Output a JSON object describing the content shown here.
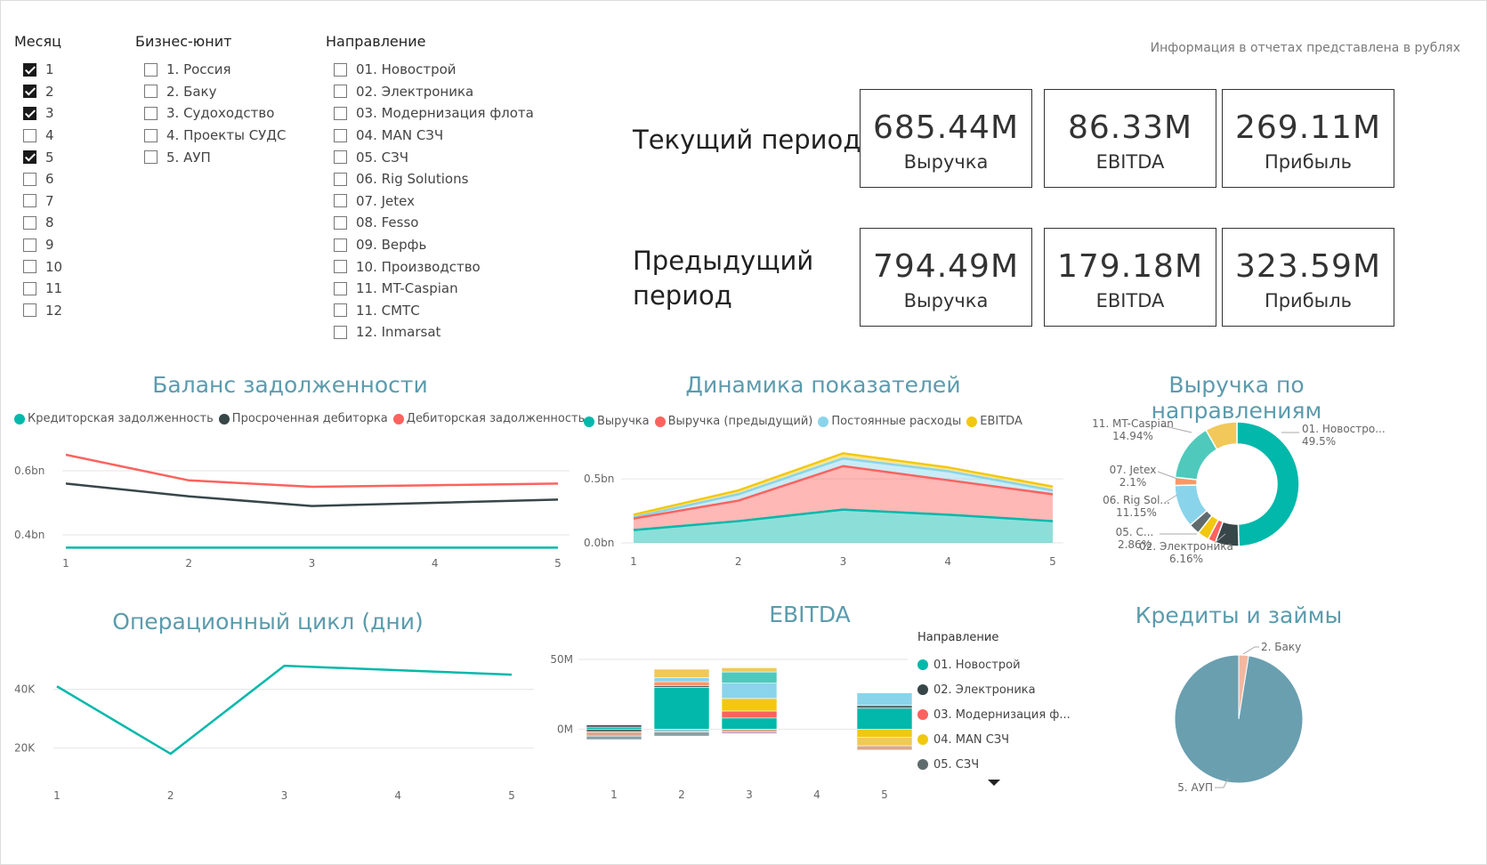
{
  "slicers": {
    "month": {
      "title": "Месяц",
      "items": [
        {
          "label": "1",
          "checked": true
        },
        {
          "label": "2",
          "checked": true
        },
        {
          "label": "3",
          "checked": true
        },
        {
          "label": "4",
          "checked": false
        },
        {
          "label": "5",
          "checked": true
        },
        {
          "label": "6",
          "checked": false
        },
        {
          "label": "7",
          "checked": false
        },
        {
          "label": "8",
          "checked": false
        },
        {
          "label": "9",
          "checked": false
        },
        {
          "label": "10",
          "checked": false
        },
        {
          "label": "11",
          "checked": false
        },
        {
          "label": "12",
          "checked": false
        }
      ]
    },
    "unit": {
      "title": "Бизнес-юнит",
      "items": [
        {
          "label": "1. Россия",
          "checked": false
        },
        {
          "label": "2. Баку",
          "checked": false
        },
        {
          "label": "3. Судоходство",
          "checked": false
        },
        {
          "label": "4. Проекты СУДС",
          "checked": false
        },
        {
          "label": "5. АУП",
          "checked": false
        }
      ]
    },
    "direction": {
      "title": "Направление",
      "items": [
        {
          "label": "01. Новострой",
          "checked": false
        },
        {
          "label": "02. Электроника",
          "checked": false
        },
        {
          "label": "03. Модернизация флота",
          "checked": false
        },
        {
          "label": "04. MAN СЗЧ",
          "checked": false
        },
        {
          "label": "05. СЗЧ",
          "checked": false
        },
        {
          "label": "06. Rig Solutions",
          "checked": false
        },
        {
          "label": "07. Jetex",
          "checked": false
        },
        {
          "label": "08. Fesso",
          "checked": false
        },
        {
          "label": "09. Верфь",
          "checked": false
        },
        {
          "label": "10. Производство",
          "checked": false
        },
        {
          "label": "11. MT-Caspian",
          "checked": false
        },
        {
          "label": "11. СМТС",
          "checked": false
        },
        {
          "label": "12. Inmarsat",
          "checked": false
        }
      ]
    }
  },
  "info_note": "Информация в отчетах представлена в рублях",
  "current": {
    "label": "Текущий период",
    "cards": [
      {
        "value": "685.44M",
        "label": "Выручка"
      },
      {
        "value": "86.33M",
        "label": "EBITDA"
      },
      {
        "value": "269.11M",
        "label": "Прибыль"
      }
    ]
  },
  "previous": {
    "label_line1": "Предыдущий",
    "label_line2": "период",
    "cards": [
      {
        "value": "794.49M",
        "label": "Выручка"
      },
      {
        "value": "179.18M",
        "label": "EBITDA"
      },
      {
        "value": "323.59M",
        "label": "Прибыль"
      }
    ]
  },
  "colors": {
    "teal": "#01b8aa",
    "dark": "#374649",
    "red": "#fd625e",
    "yellow": "#f2c80f",
    "gray": "#5f6b6d",
    "lightblue": "#8ad4eb",
    "orange": "#fe9666",
    "purple": "#a66999",
    "steel": "#6a9fb0",
    "peach": "#f4b8a0",
    "title": "#5b9bad"
  },
  "chart_data": [
    {
      "id": "debt",
      "type": "line",
      "title": "Баланс задолженности",
      "x": [
        "1",
        "2",
        "3",
        "4",
        "5"
      ],
      "y_ticks": [
        "0.4bn",
        "0.6bn"
      ],
      "ylim": [
        0.3,
        0.7
      ],
      "series": [
        {
          "name": "Кредиторская задолженность",
          "color": "#01b8aa",
          "values": [
            0.36,
            0.36,
            0.36,
            0.36,
            0.36
          ]
        },
        {
          "name": "Просроченная дебиторка",
          "color": "#374649",
          "values": [
            0.56,
            0.52,
            0.49,
            0.5,
            0.51
          ]
        },
        {
          "name": "Дебиторская задолженность",
          "color": "#fd625e",
          "values": [
            0.65,
            0.57,
            0.55,
            0.555,
            0.56
          ]
        }
      ]
    },
    {
      "id": "dynamics",
      "type": "area",
      "title": "Динамика показателей",
      "x": [
        "1",
        "2",
        "3",
        "4",
        "5"
      ],
      "y_ticks": [
        "0.0bn",
        "0.5bn"
      ],
      "ylim": [
        0,
        0.8
      ],
      "series": [
        {
          "name": "Выручка",
          "color": "#01b8aa",
          "values": [
            0.1,
            0.17,
            0.26,
            0.22,
            0.17
          ]
        },
        {
          "name": "Выручка (предыдущий)",
          "color": "#fd625e",
          "values": [
            0.19,
            0.33,
            0.6,
            0.49,
            0.38
          ]
        },
        {
          "name": "Постоянные расходы",
          "color": "#8ad4eb",
          "values": [
            0.2,
            0.38,
            0.66,
            0.56,
            0.41
          ]
        },
        {
          "name": "EBITDA",
          "color": "#f2c80f",
          "values": [
            0.22,
            0.41,
            0.7,
            0.59,
            0.44
          ]
        }
      ]
    },
    {
      "id": "rev_dir",
      "type": "pie",
      "title": "Выручка по направлениям",
      "labels": [
        {
          "name": "01. Новостро...",
          "pct": "49.5%"
        },
        {
          "name": "02. Электроника",
          "pct": "6.16%"
        },
        {
          "name": "05. С...",
          "pct": "2.86%"
        },
        {
          "name": "06. Rig Sol...",
          "pct": "11.15%"
        },
        {
          "name": "07. Jetex",
          "pct": "2.1%"
        },
        {
          "name": "11. MT-Caspian",
          "pct": "14.94%"
        }
      ],
      "slices": [
        {
          "value": 49.5,
          "color": "#01b8aa"
        },
        {
          "value": 6.16,
          "color": "#374649"
        },
        {
          "value": 2.0,
          "color": "#fd625e"
        },
        {
          "value": 3.0,
          "color": "#f2c80f"
        },
        {
          "value": 2.86,
          "color": "#5f6b6d"
        },
        {
          "value": 11.15,
          "color": "#8ad4eb"
        },
        {
          "value": 2.1,
          "color": "#fe9666"
        },
        {
          "value": 14.94,
          "color": "#4fc9bb"
        },
        {
          "value": 8.29,
          "color": "#f2c85a"
        }
      ]
    },
    {
      "id": "opcycle",
      "type": "line",
      "title": "Операционный цикл (дни)",
      "x": [
        "1",
        "2",
        "3",
        "4",
        "5"
      ],
      "y_ticks": [
        "20K",
        "40K"
      ],
      "ylim": [
        8000,
        52000
      ],
      "series": [
        {
          "color": "#01b8aa",
          "values": [
            41000,
            18000,
            48000,
            46500,
            45000
          ]
        }
      ]
    },
    {
      "id": "ebitda",
      "type": "bar",
      "title": "EBITDA",
      "x": [
        "1",
        "2",
        "3",
        "4",
        "5"
      ],
      "y_ticks": [
        "0M",
        "50M"
      ],
      "ylim": [
        -10,
        50
      ],
      "legend_title": "Направление",
      "legend": [
        {
          "name": "01. Новострой",
          "color": "#01b8aa"
        },
        {
          "name": "02. Электроника",
          "color": "#374649"
        },
        {
          "name": "03. Модернизация ф...",
          "color": "#fd625e"
        },
        {
          "name": "04. MAN СЗЧ",
          "color": "#f2c80f"
        },
        {
          "name": "05. СЗЧ",
          "color": "#5f6b6d"
        }
      ],
      "stacks": [
        [
          {
            "v": 1.5,
            "c": "#01b8aa"
          },
          {
            "v": 1.5,
            "c": "#374649"
          },
          {
            "v": -2,
            "c": "#5f6b6d"
          },
          {
            "v": -3,
            "c": "#d9a98c"
          },
          {
            "v": -2.5,
            "c": "#8aa0a6"
          }
        ],
        [
          {
            "v": 30,
            "c": "#01b8aa"
          },
          {
            "v": 1,
            "c": "#374649"
          },
          {
            "v": 3,
            "c": "#fe9666"
          },
          {
            "v": 3,
            "c": "#8ad4eb"
          },
          {
            "v": 6,
            "c": "#f2c85a"
          },
          {
            "v": -2,
            "c": "#a0c8d0"
          },
          {
            "v": -3,
            "c": "#8aa0a6"
          }
        ],
        [
          {
            "v": 8,
            "c": "#01b8aa"
          },
          {
            "v": 5,
            "c": "#fd625e"
          },
          {
            "v": 9,
            "c": "#f2c80f"
          },
          {
            "v": 11,
            "c": "#8ad4eb"
          },
          {
            "v": 8,
            "c": "#4fc9bb"
          },
          {
            "v": 3,
            "c": "#f2c85a"
          },
          {
            "v": -2,
            "c": "#d9a98c"
          },
          {
            "v": -1,
            "c": "#a66999"
          }
        ],
        [],
        [
          {
            "v": 15,
            "c": "#01b8aa"
          },
          {
            "v": 2,
            "c": "#5f6b6d"
          },
          {
            "v": 9,
            "c": "#8ad4eb"
          },
          {
            "v": -6,
            "c": "#f2c80f"
          },
          {
            "v": -6,
            "c": "#f2c85a"
          },
          {
            "v": -3,
            "c": "#d9a98c"
          }
        ]
      ]
    },
    {
      "id": "loans",
      "type": "pie",
      "title": "Кредиты и займы",
      "slices": [
        {
          "name": "2. Баку",
          "value": 2.5,
          "color": "#f4b8a0"
        },
        {
          "name": "5. АУП",
          "value": 97.5,
          "color": "#6a9fb0"
        }
      ]
    }
  ]
}
